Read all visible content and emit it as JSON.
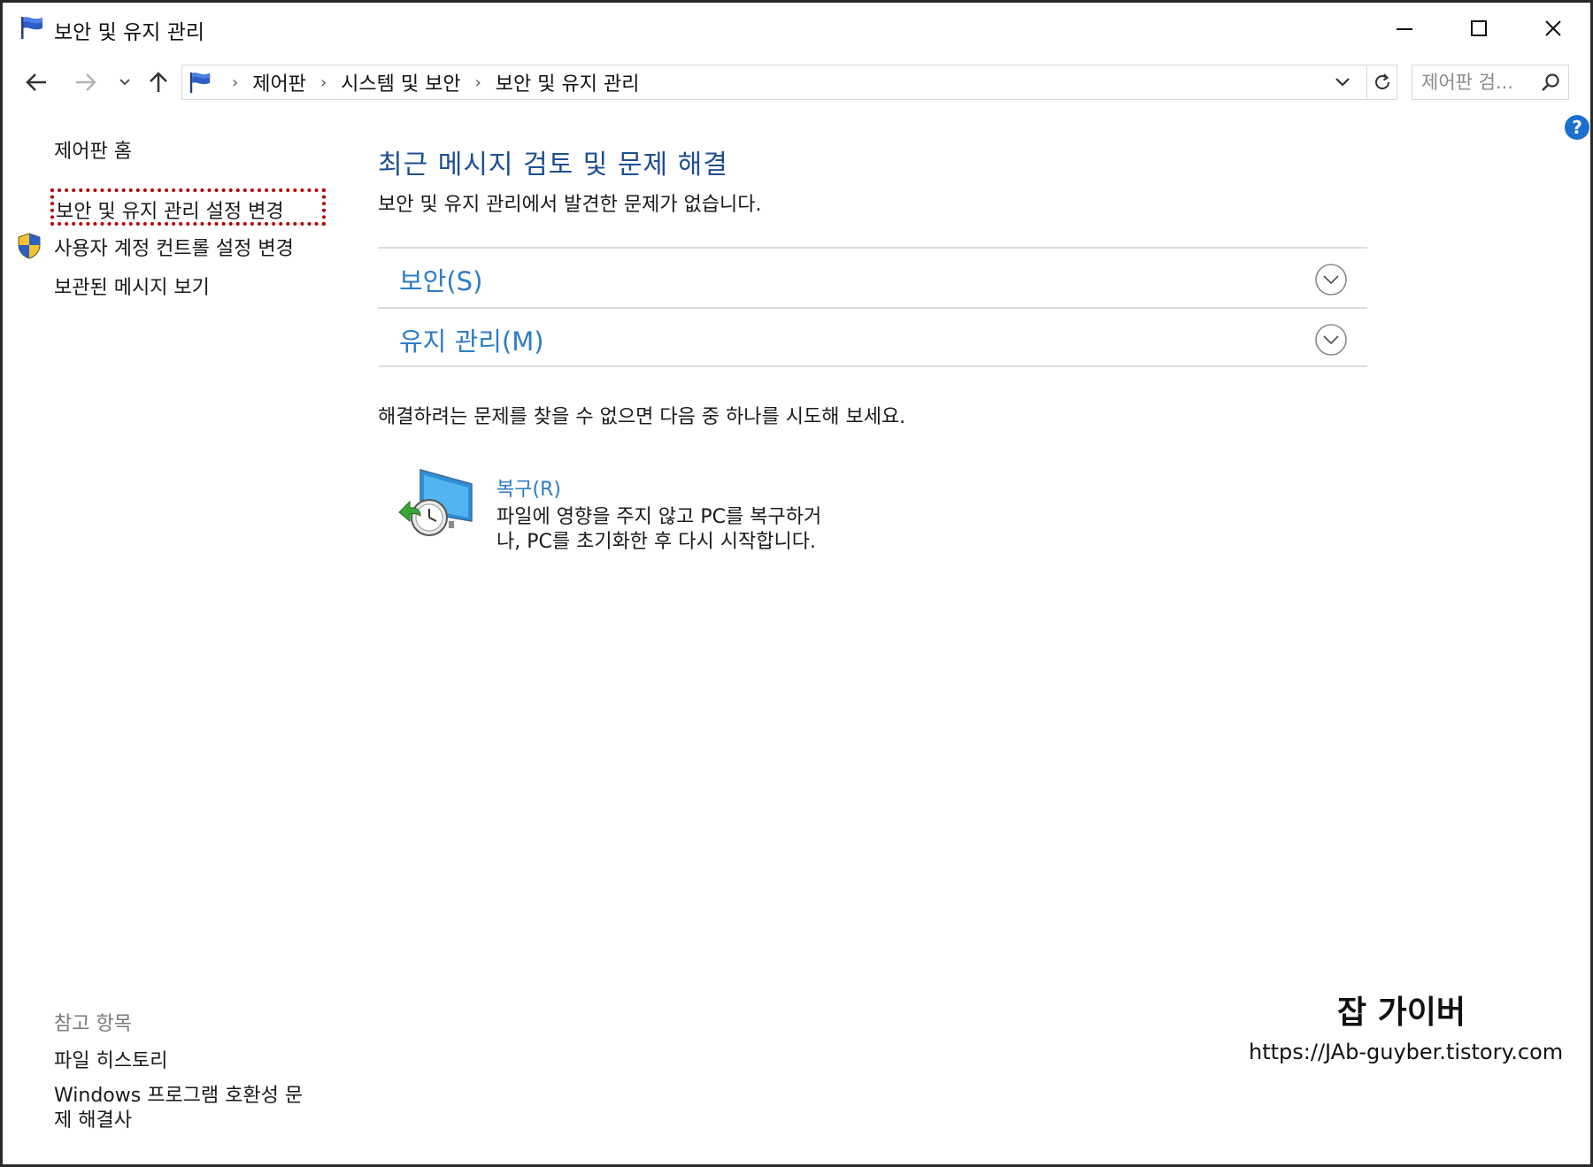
{
  "window": {
    "title": "보안 및 유지 관리",
    "controls": [
      "minimize-icon",
      "maximize-icon",
      "close-icon"
    ]
  },
  "address_bar": {
    "breadcrumbs": [
      "제어판",
      "시스템 및 보안",
      "보안 및 유지 관리"
    ],
    "separator": "›",
    "search_placeholder": "제어판 검..."
  },
  "left_nav": {
    "home": "제어판 홈",
    "items": [
      {
        "label": "보안 및 유지 관리 설정 변경",
        "highlighted": true
      },
      {
        "label": "사용자 계정 컨트롤 설정 변경",
        "icon": "uac-shield-icon"
      },
      {
        "label": "보관된 메시지 보기"
      }
    ],
    "see_also": {
      "title": "참고 항목",
      "items": [
        "파일 히스토리",
        "Windows 프로그램 호환성 문제 해결사"
      ]
    }
  },
  "main": {
    "title": "최근 메시지 검토 및 문제 해결",
    "subtitle": "보안 및 유지 관리에서 발견한 문제가 없습니다.",
    "sections": [
      {
        "label": "보안(S)",
        "state": "collapsed"
      },
      {
        "label": "유지 관리(M)",
        "state": "collapsed"
      }
    ],
    "try_text": "해결하려는 문제를 찾을 수 없으면 다음 중 하나를 시도해 보세요.",
    "recovery": {
      "link": "복구(R)",
      "description": "파일에 영향을 주지 않고 PC를 복구하거나, PC를 초기화한 후 다시 시작합니다."
    }
  },
  "watermark": {
    "name": "잡 가이버",
    "url": "https://JAb-guyber.tistory.com"
  },
  "colors": {
    "title_blue": "#1e4f91",
    "link_blue": "#2d7cc6",
    "highlight_red": "#b30000",
    "help_blue": "#1a6fd0"
  }
}
